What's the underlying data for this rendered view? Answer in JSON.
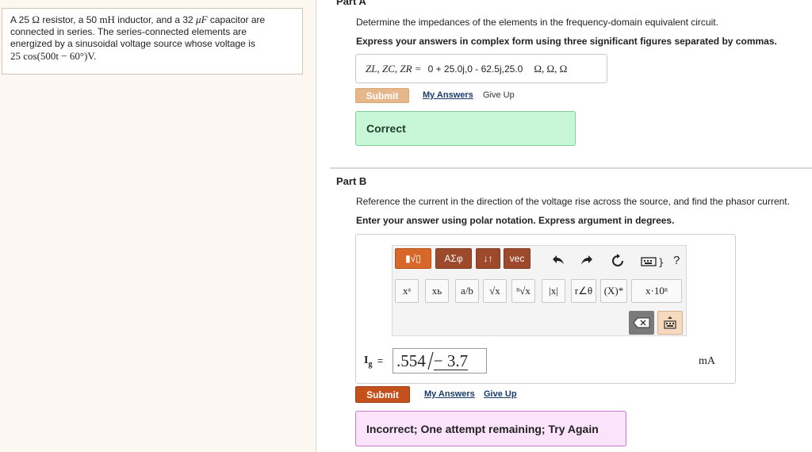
{
  "problem": {
    "line1_a": "A 25",
    "line1_ohm": "Ω",
    "line1_b": "resistor, a 50",
    "line1_mh": "mH",
    "line1_c": "inductor, and a 32",
    "line1_uf": "μF",
    "line1_d": "capacitor are",
    "line2": "connected in series. The series-connected elements are",
    "line3": "energized by a sinusoidal voltage source whose voltage is",
    "line4": "25 cos(500t − 60°)V."
  },
  "partA": {
    "title": "Part A",
    "prompt": "Determine the impedances of the elements in the frequency-domain equivalent circuit.",
    "instruction": "Express your answers in complex form using three significant figures separated by commas.",
    "answer_label": "Z",
    "answer_label_full": "ZL, ZC, ZR =",
    "answer_value": "0 + 25.0j,0 - 62.5j,25.0",
    "answer_units": "Ω, Ω, Ω",
    "submit_label": "Submit",
    "my_answers_label": "My Answers",
    "give_up_label": "Give Up",
    "feedback": "Correct"
  },
  "partB": {
    "title": "Part B",
    "prompt": "Reference the current in the direction of the voltage rise across the source, and find the phasor current.",
    "instruction": "Enter your answer using polar notation. Express argument in degrees.",
    "toolbar": {
      "templates_label": "▮√▯",
      "greek_label": "ΑΣφ",
      "arrows_label": "↓↑",
      "vec_label": "vec",
      "help_label": "?"
    },
    "keys": [
      "xᵃ",
      "xь",
      "a/b",
      "√x",
      "ⁿ√x",
      "|x|",
      "r∠θ",
      "(X)*",
      "x·10ⁿ"
    ],
    "input_label": "I",
    "input_subscript": "g",
    "input_equals": "=",
    "input_magnitude": ".554",
    "input_angle": "− 3.7",
    "input_units": "mA",
    "submit_label": "Submit",
    "my_answers_label": "My Answers",
    "give_up_label": "Give Up",
    "feedback": "Incorrect; One attempt remaining; Try Again"
  },
  "colors": {
    "submit_active": "#c6501b",
    "submit_disabled": "#e7b78c",
    "correct_bg": "#c8f7d8",
    "incorrect_bg": "#fbe3fb"
  }
}
